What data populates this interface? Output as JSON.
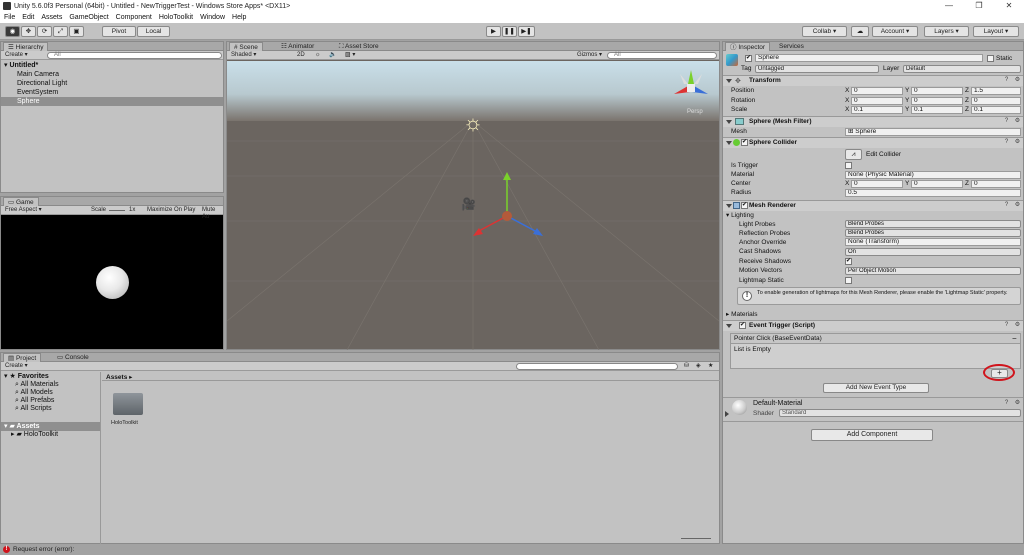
{
  "window": {
    "title": "Unity 5.6.0f3 Personal (64bit) - Untitled - NewTriggerTest - Windows Store Apps* <DX11>"
  },
  "menu": [
    "File",
    "Edit",
    "Assets",
    "GameObject",
    "Component",
    "HoloToolkit",
    "Window",
    "Help"
  ],
  "toolbar": {
    "pivot": "Pivot",
    "local": "Local",
    "collab": "Collab",
    "account": "Account",
    "layers": "Layers",
    "layout": "Layout"
  },
  "hierarchy": {
    "tab": "Hierarchy",
    "create": "Create",
    "search_placeholder": "All",
    "scene": "Untitled*",
    "items": [
      "Main Camera",
      "Directional Light",
      "EventSystem",
      "Sphere"
    ]
  },
  "scene": {
    "tabs": [
      "Scene",
      "Animator",
      "Asset Store"
    ],
    "shading": "Shaded",
    "mode2d": "2D",
    "gizmos": "Gizmos",
    "search_placeholder": "All",
    "persp": "Persp"
  },
  "game": {
    "tab": "Game",
    "aspect": "Free Aspect",
    "scale_label": "Scale",
    "scale_value": "1x",
    "maximize": "Maximize On Play",
    "mute": "Mute Au"
  },
  "project": {
    "tabs": [
      "Project",
      "Console"
    ],
    "create": "Create",
    "favorites": "Favorites",
    "fav_items": [
      "All Materials",
      "All Models",
      "All Prefabs",
      "All Scripts"
    ],
    "assets_root": "Assets",
    "assets_children": [
      "HoloToolkit"
    ],
    "breadcrumb": "Assets",
    "folder_label": "HoloToolkit"
  },
  "inspector": {
    "tabs": [
      "Inspector",
      "Services"
    ],
    "object_name": "Sphere",
    "static": "Static",
    "tag_label": "Tag",
    "tag_value": "Untagged",
    "layer_label": "Layer",
    "layer_value": "Default",
    "transform": {
      "title": "Transform",
      "position_label": "Position",
      "rotation_label": "Rotation",
      "scale_label": "Scale",
      "position": [
        "0",
        "0",
        "1.5"
      ],
      "rotation": [
        "0",
        "0",
        "0"
      ],
      "scale": [
        "0.1",
        "0.1",
        "0.1"
      ]
    },
    "axis": [
      "X",
      "Y",
      "Z"
    ],
    "mesh_filter": {
      "title": "Sphere (Mesh Filter)",
      "mesh_label": "Mesh",
      "mesh_value": "Sphere"
    },
    "sphere_collider": {
      "title": "Sphere Collider",
      "edit_collider": "Edit Collider",
      "is_trigger_label": "Is Trigger",
      "material_label": "Material",
      "material_value": "None (Physic Material)",
      "center_label": "Center",
      "center": [
        "0",
        "0",
        "0"
      ],
      "radius_label": "Radius",
      "radius_value": "0.5"
    },
    "mesh_renderer": {
      "title": "Mesh Renderer",
      "lighting": "Lighting",
      "light_probes_label": "Light Probes",
      "light_probes_value": "Blend Probes",
      "reflection_probes_label": "Reflection Probes",
      "reflection_probes_value": "Blend Probes",
      "anchor_override_label": "Anchor Override",
      "anchor_override_value": "None (Transform)",
      "cast_shadows_label": "Cast Shadows",
      "cast_shadows_value": "On",
      "receive_shadows_label": "Receive Shadows",
      "motion_vectors_label": "Motion Vectors",
      "motion_vectors_value": "Per Object Motion",
      "lightmap_static_label": "Lightmap Static",
      "info": "To enable generation of lightmaps for this Mesh Renderer, please enable the 'Lightmap Static' property.",
      "materials": "Materials"
    },
    "event_trigger": {
      "title": "Event Trigger (Script)",
      "entry": "Pointer Click (BaseEventData)",
      "list_empty": "List is Empty",
      "plus": "+",
      "minus": "−",
      "add_new": "Add New Event Type"
    },
    "material": {
      "name": "Default-Material",
      "shader_label": "Shader",
      "shader_value": "Standard"
    },
    "add_component": "Add Component"
  },
  "status": {
    "error": "Request error (error):"
  },
  "colors": {
    "highlight_circle": "#d0141c",
    "scene_ground": "#6b6560",
    "scene_sky": "#c9dfe9"
  }
}
